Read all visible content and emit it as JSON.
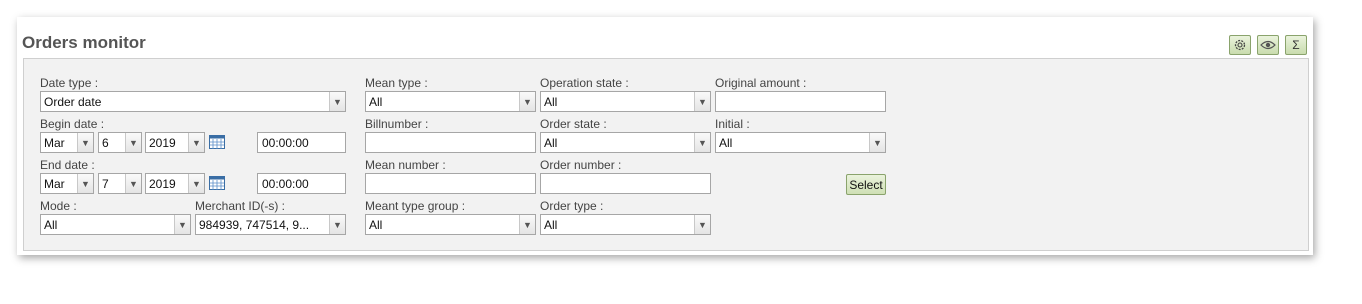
{
  "header": {
    "title": "Orders monitor"
  },
  "toolbar": {
    "settings_icon": "gear-icon",
    "view_icon": "eye-icon",
    "sum_label": "Σ"
  },
  "form": {
    "date_type": {
      "label": "Date type :",
      "value": "Order date"
    },
    "begin_date": {
      "label": "Begin date :",
      "month": "Mar",
      "day": "6",
      "year": "2019",
      "time": "00:00:00"
    },
    "end_date": {
      "label": "End date :",
      "month": "Mar",
      "day": "7",
      "year": "2019",
      "time": "00:00:00"
    },
    "mode": {
      "label": "Mode :",
      "value": "All"
    },
    "merchant": {
      "label": "Merchant ID(-s) :",
      "value": "984939, 747514, 9..."
    },
    "mean_type": {
      "label": "Mean type :",
      "value": "All"
    },
    "billnumber": {
      "label": "Billnumber :",
      "value": ""
    },
    "mean_number": {
      "label": "Mean number :",
      "value": ""
    },
    "meant_type_group": {
      "label": "Meant type group :",
      "value": "All"
    },
    "operation_state": {
      "label": "Operation state :",
      "value": "All"
    },
    "order_state": {
      "label": "Order state :",
      "value": "All"
    },
    "order_number": {
      "label": "Order number :",
      "value": ""
    },
    "order_type": {
      "label": "Order type :",
      "value": "All"
    },
    "original_amount": {
      "label": "Original amount :",
      "value": ""
    },
    "initial": {
      "label": "Initial :",
      "value": "All"
    },
    "select_label": "Select"
  }
}
